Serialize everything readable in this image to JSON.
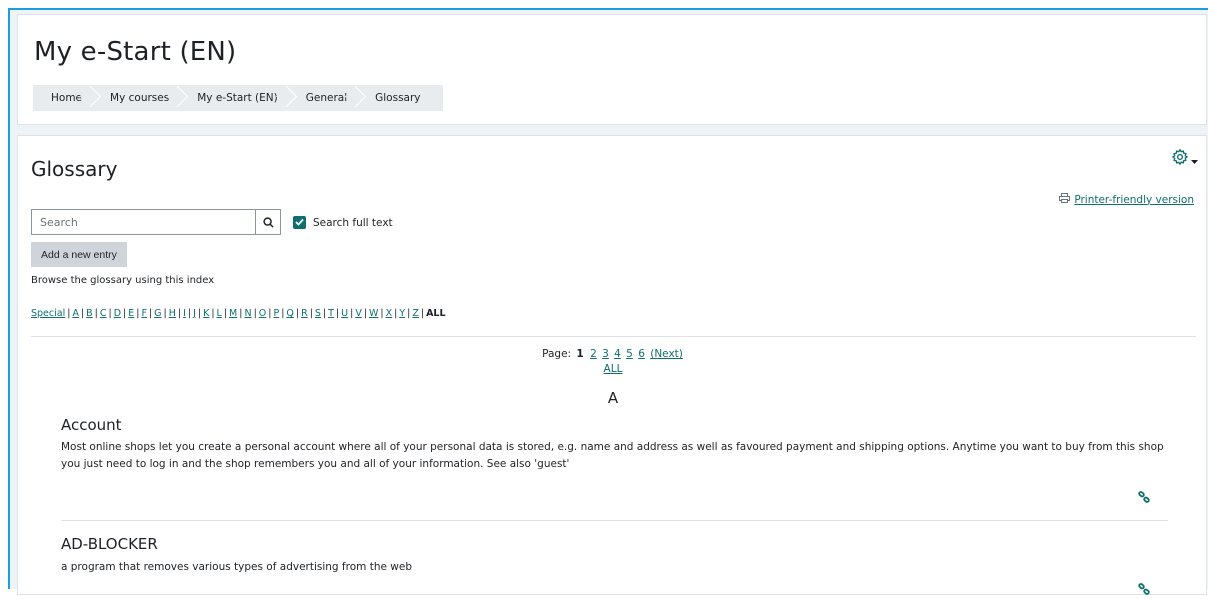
{
  "header": {
    "course_title": "My e-Start (EN)",
    "breadcrumb": [
      "Home",
      "My courses",
      "My e-Start (EN)",
      "General",
      "Glossary"
    ]
  },
  "main": {
    "heading": "Glossary",
    "printer_label": "Printer-friendly version",
    "search": {
      "placeholder": "Search",
      "value": ""
    },
    "full_text_label": "Search full text",
    "full_text_checked": true,
    "add_entry_label": "Add a new entry",
    "browse_text": "Browse the glossary using this index",
    "index": {
      "special": "Special",
      "letters": [
        "A",
        "B",
        "C",
        "D",
        "E",
        "F",
        "G",
        "H",
        "I",
        "J",
        "K",
        "L",
        "M",
        "N",
        "O",
        "P",
        "Q",
        "R",
        "S",
        "T",
        "U",
        "V",
        "W",
        "X",
        "Y",
        "Z"
      ],
      "all": "ALL"
    },
    "paging": {
      "label": "Page:",
      "current": "1",
      "pages": [
        "2",
        "3",
        "4",
        "5",
        "6"
      ],
      "next": "(Next)",
      "all": "ALL"
    },
    "letter_heading": "A",
    "entries": [
      {
        "title": "Account",
        "body": "Most online shops let you create a personal account where all of your personal data is stored, e.g. name and address as well as favoured payment and shipping options. Anytime you want to buy from this shop you just need to log in and the shop remembers you and all of your information. See also 'guest'"
      },
      {
        "title": "AD-BLOCKER",
        "body": "a program that removes various types of advertising from the web"
      }
    ]
  },
  "colors": {
    "accent": "#0f6e6e",
    "frame_border": "#1a9fdc",
    "page_bg": "#eef3f7",
    "breadcrumb_bg": "#e9ecef",
    "button_bg": "#ced4da"
  },
  "icons": [
    "search-icon",
    "gear-icon",
    "chevron-down-icon",
    "printer-icon",
    "link-icon",
    "checkmark-icon"
  ]
}
